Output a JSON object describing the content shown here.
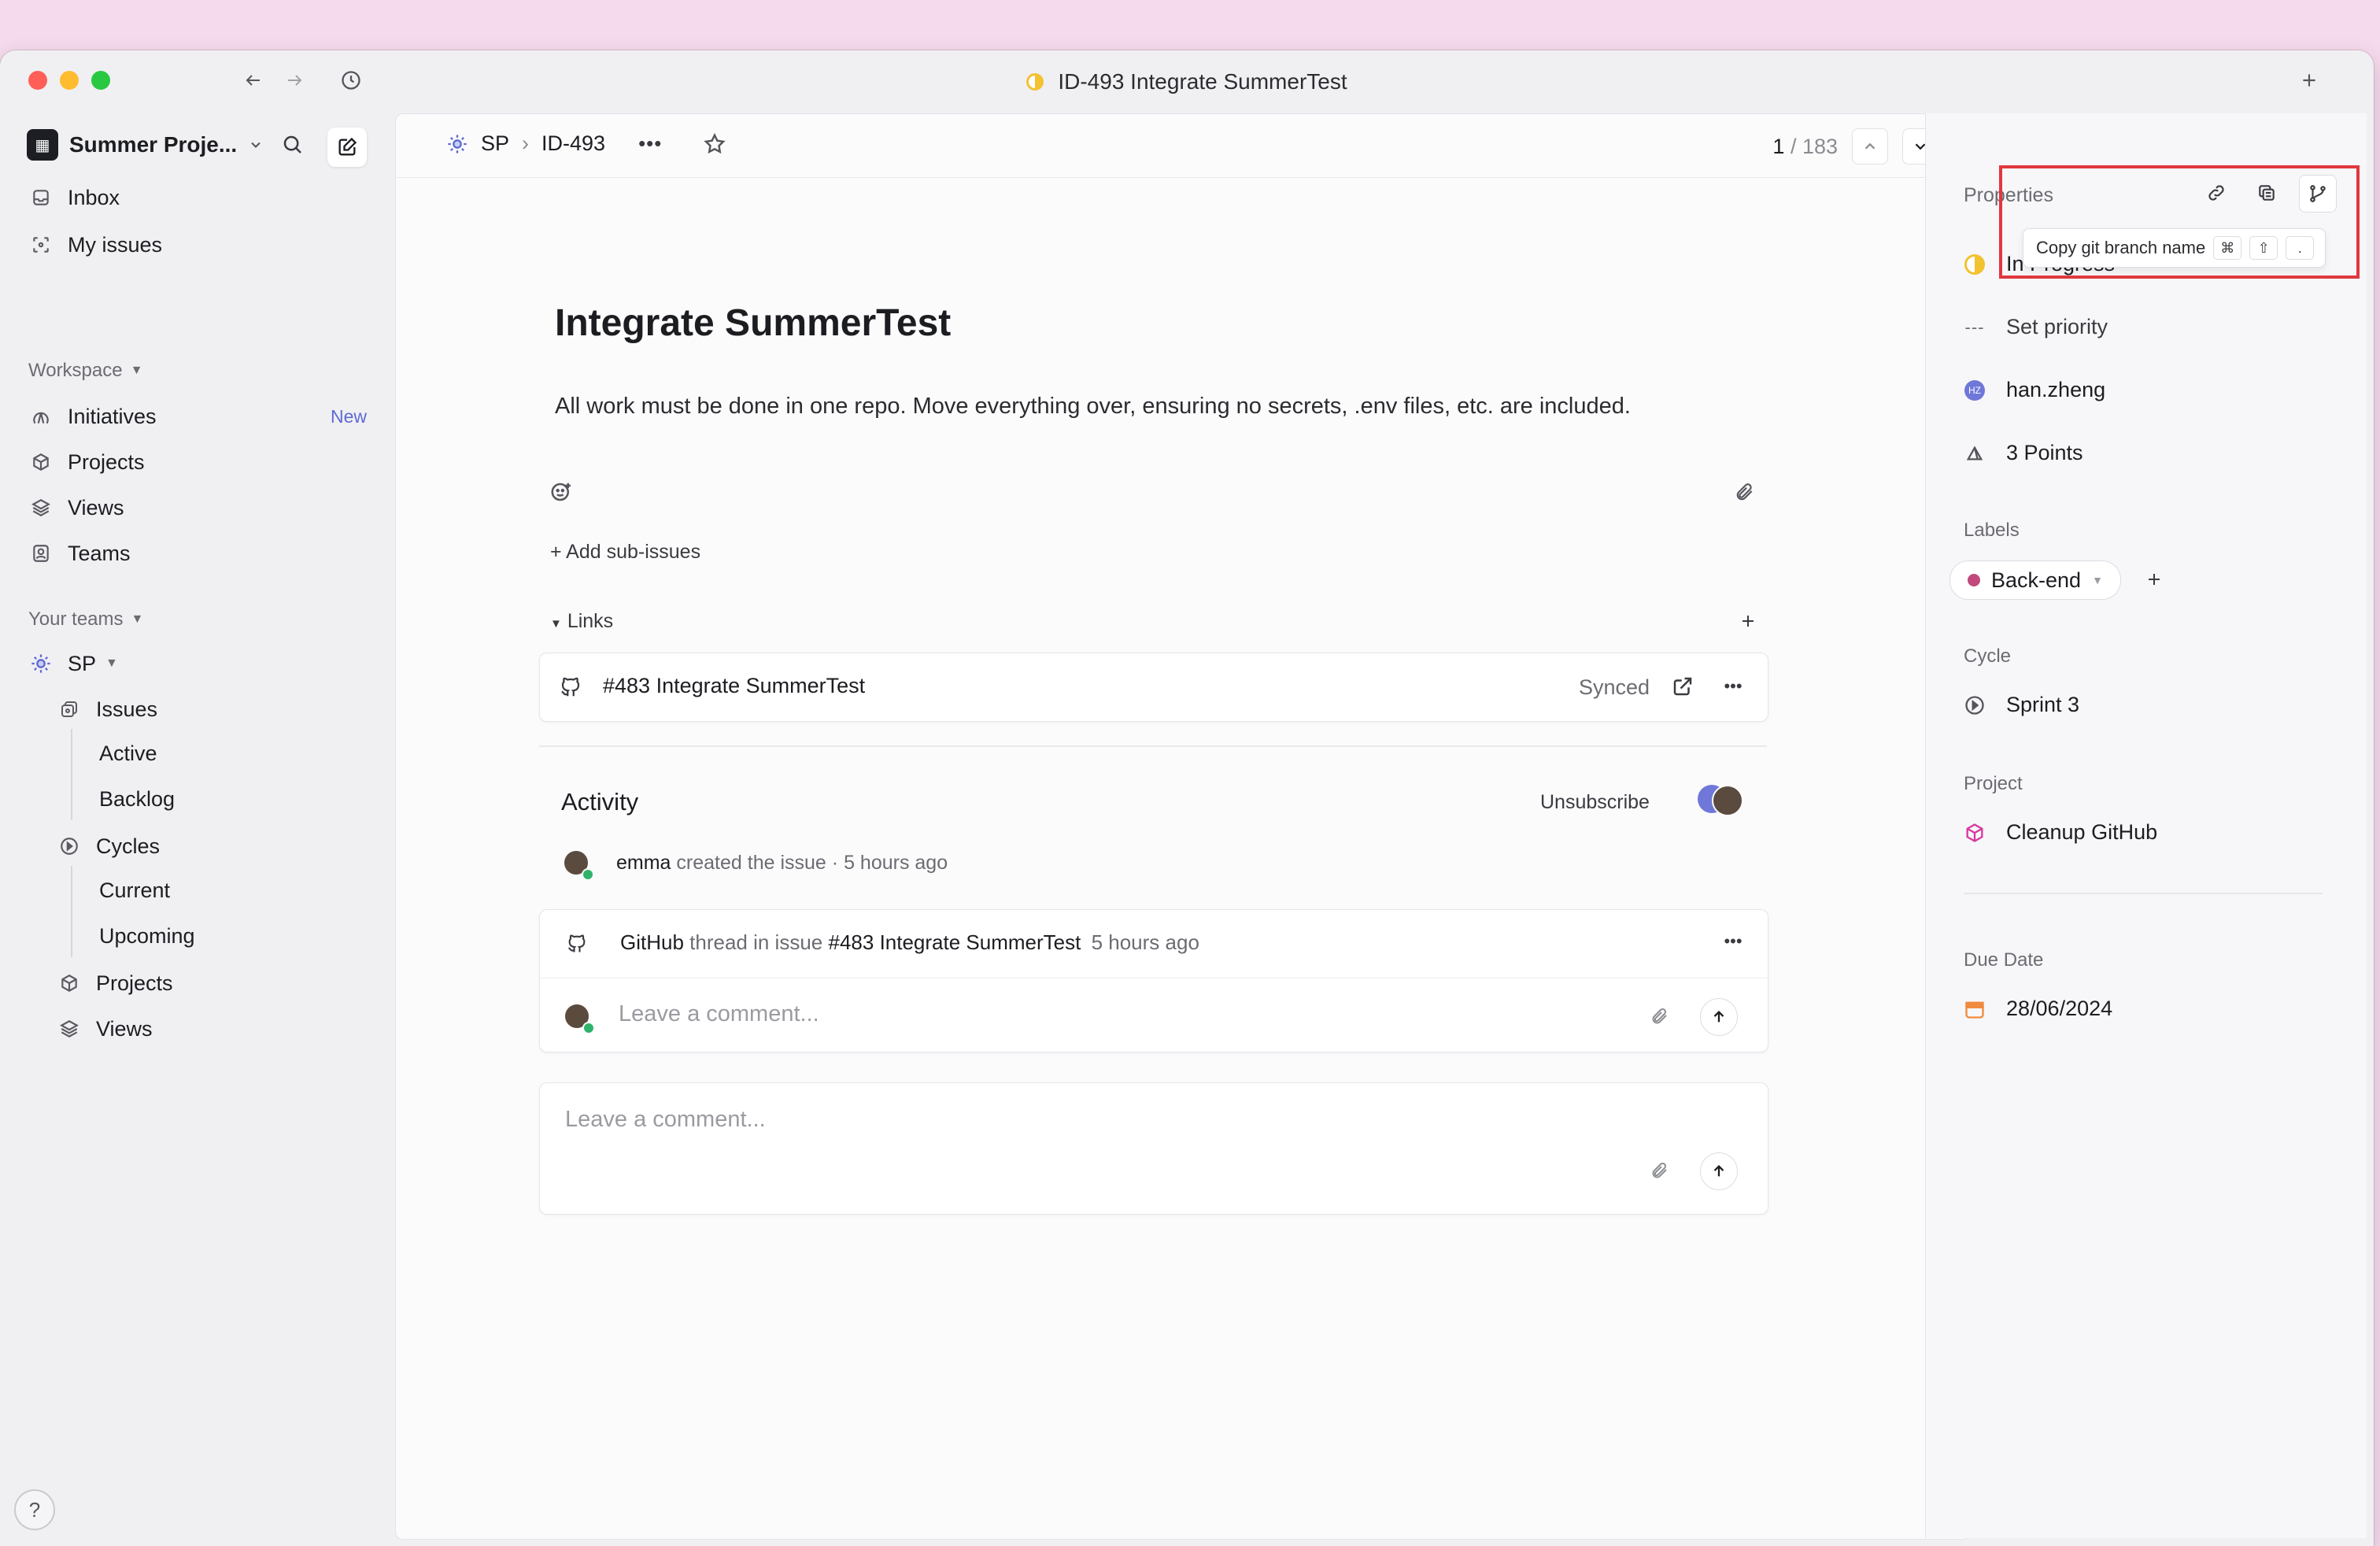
{
  "window": {
    "title": "ID-493 Integrate SummerTest"
  },
  "sidebar": {
    "workspace_name": "Summer Proje...",
    "nav": [
      {
        "label": "Inbox"
      },
      {
        "label": "My issues"
      }
    ],
    "workspace_section": "Workspace",
    "workspace_items": [
      {
        "label": "Initiatives",
        "badge": "New"
      },
      {
        "label": "Projects"
      },
      {
        "label": "Views"
      },
      {
        "label": "Teams"
      }
    ],
    "teams_section": "Your teams",
    "team": {
      "name": "SP"
    },
    "team_items": {
      "issues": "Issues",
      "active": "Active",
      "backlog": "Backlog",
      "cycles": "Cycles",
      "current": "Current",
      "upcoming": "Upcoming",
      "projects": "Projects",
      "views": "Views"
    },
    "help": "?"
  },
  "main": {
    "breadcrumb": {
      "team": "SP",
      "issue_id": "ID-493"
    },
    "pager": {
      "current": "1",
      "total": "/ 183"
    },
    "title": "Integrate SummerTest",
    "description": "All work must be done in one repo. Move everything over, ensuring no secrets, .env files, etc. are included.",
    "add_sub_issues": "+ Add sub-issues",
    "links_heading": "Links",
    "link": {
      "label": "#483 Integrate SummerTest",
      "status": "Synced"
    },
    "activity": {
      "title": "Activity",
      "unsubscribe": "Unsubscribe",
      "event_user": "emma",
      "event_text": "created the issue",
      "event_dot": "·",
      "event_time": "5 hours ago",
      "thread_source": "GitHub",
      "thread_text": "thread in issue",
      "thread_issue": "#483 Integrate SummerTest",
      "thread_time": "5 hours ago",
      "reply_placeholder": "Leave a comment..."
    },
    "comment_placeholder": "Leave a comment..."
  },
  "properties": {
    "heading": "Properties",
    "tooltip": {
      "label": "Copy git branch name",
      "keys": [
        "⌘",
        "⇧",
        "."
      ]
    },
    "status": "In Progress",
    "priority": "Set priority",
    "assignee": "han.zheng",
    "estimate": "3 Points",
    "labels_heading": "Labels",
    "label_chip": "Back-end",
    "cycle_heading": "Cycle",
    "cycle": "Sprint 3",
    "project_heading": "Project",
    "project": "Cleanup GitHub",
    "due_heading": "Due Date",
    "due_date": "28/06/2024"
  },
  "colors": {
    "accent": "#5e6ad2",
    "label_backend": "#c2497e",
    "status_in_progress": "#f2c230",
    "highlight": "#e0383e",
    "project": "#d63aa0",
    "due": "#f08a3c"
  }
}
